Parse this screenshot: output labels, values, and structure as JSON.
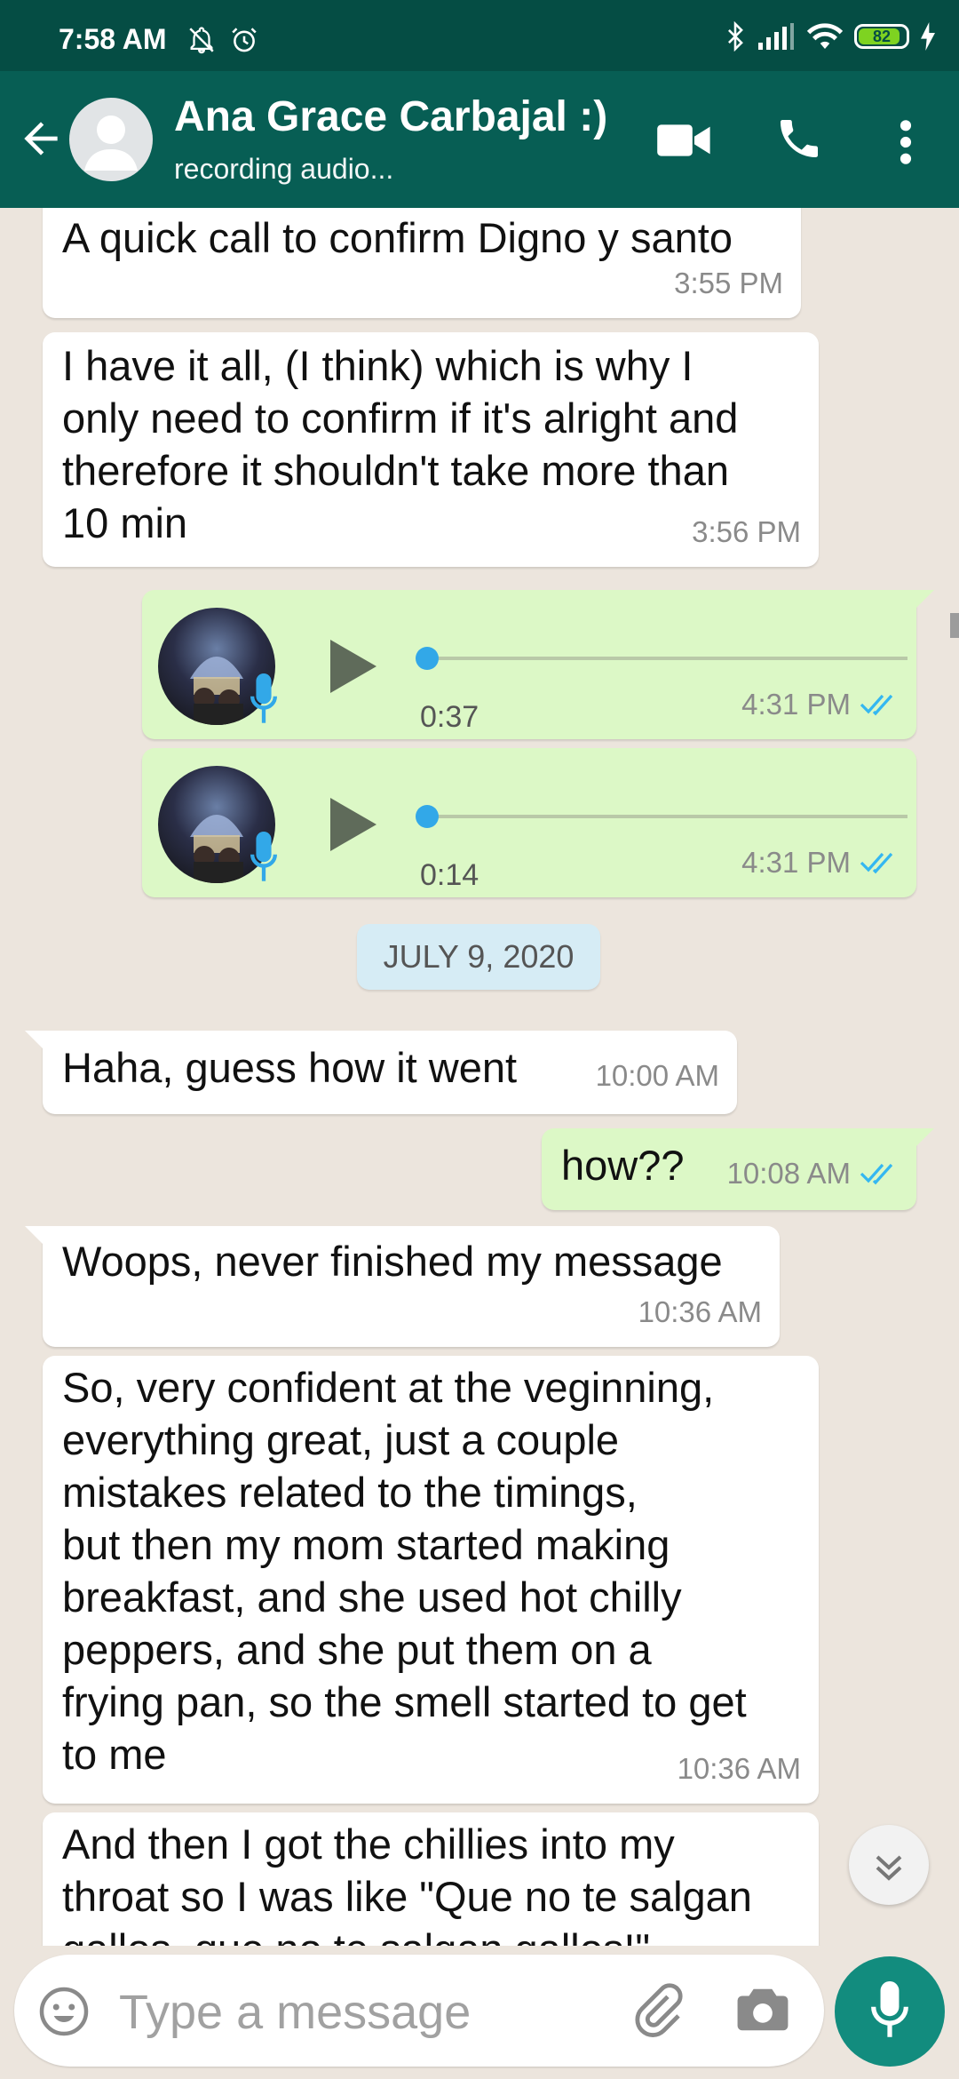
{
  "status_bar": {
    "time": "7:58 AM",
    "battery": "82",
    "icons": [
      "bell-off-icon",
      "alarm-icon",
      "bluetooth-icon",
      "signal-icon",
      "wifi-icon",
      "battery-icon",
      "charging-icon"
    ]
  },
  "header": {
    "title": "Ana Grace Carbajal :)",
    "subtitle": "recording audio...",
    "colors": {
      "bar": "#075e54",
      "status": "#054d44"
    }
  },
  "messages": [
    {
      "text": "A quick call to confirm Digno y santo",
      "time": "3:55 PM"
    },
    {
      "text": "I have it all, (I think) which is why I\nonly need to confirm if it's alright and\ntherefore it shouldn't take more than\n10 min",
      "time": "3:56 PM"
    },
    {
      "duration": "0:37",
      "time": "4:31 PM"
    },
    {
      "duration": "0:14",
      "time": "4:31 PM"
    },
    {
      "text": "Haha, guess how it went",
      "time": "10:00 AM"
    },
    {
      "text": "how??",
      "time": "10:08 AM"
    },
    {
      "text": "Woops, never finished my message",
      "time": "10:36 AM"
    },
    {
      "text": "So, very confident at the veginning,\neverything great, just a couple\nmistakes related to the timings,\nbut then my mom started making\nbreakfast, and she used hot chilly\npeppers, and she put them on a\nfrying pan, so the smell started to get\nto me",
      "time": "10:36 AM"
    },
    {
      "text": "And then I got the chillies into my\nthroat so I was like \"Que no te salgan\ngallos, que no te salgan gallos!\""
    }
  ],
  "date_separator": "JULY 9, 2020",
  "input": {
    "placeholder": "Type a message"
  },
  "colors": {
    "incoming": "#ffffff",
    "outgoing": "#dcf8c6",
    "tick": "#34b7f1",
    "fab": "#128c7e"
  }
}
